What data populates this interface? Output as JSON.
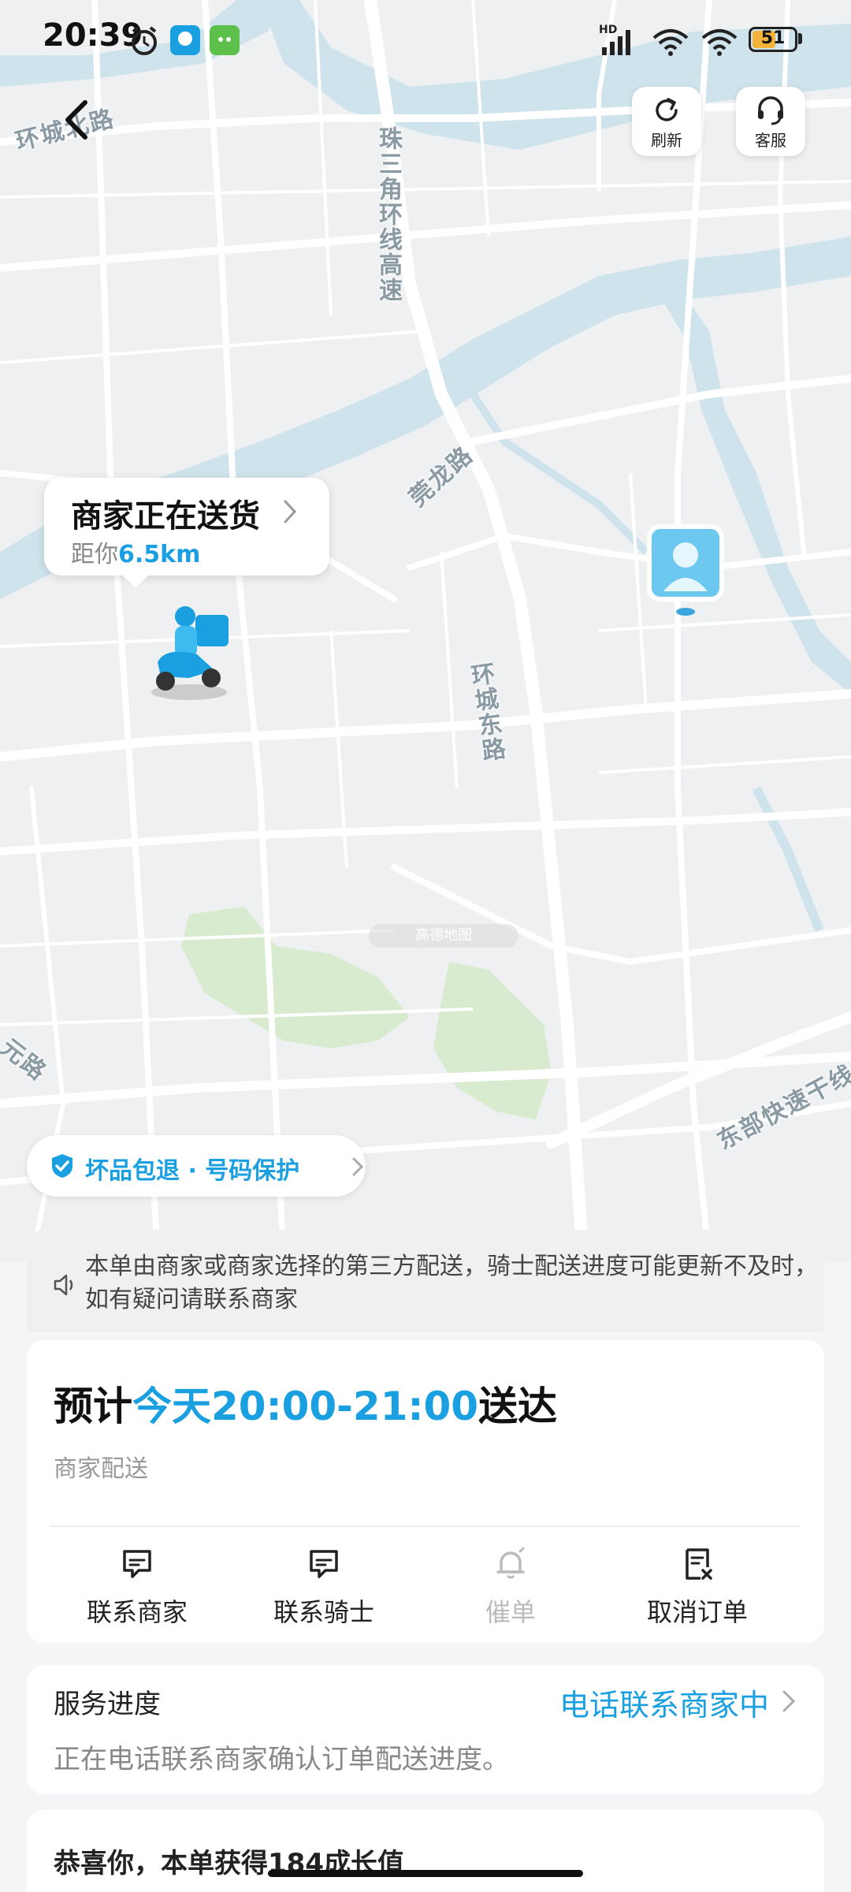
{
  "status_bar": {
    "time": "20:39",
    "signal_label": "HD",
    "battery": "51",
    "battery_level": 0.51
  },
  "top_controls": {
    "refresh_label": "刷新",
    "service_label": "客服"
  },
  "map": {
    "road_labels": [
      "环城北路",
      "珠三角环线高速",
      "莞龙路",
      "环城东路",
      "东部快速干线",
      "元路"
    ],
    "watermark": "高德地图"
  },
  "status_bubble": {
    "title": "商家正在送货",
    "distance_prefix": "距你",
    "distance": "6.5km"
  },
  "guarantee": {
    "text": "坏品包退 · 号码保护"
  },
  "notice": {
    "text": "本单由商家或商家选择的第三方配送，骑士配送进度可能更新不及时，如有疑问请联系商家"
  },
  "delivery": {
    "eta_prefix": "预计",
    "eta_time": "今天20:00-21:00",
    "eta_suffix": "送达",
    "mode": "商家配送",
    "actions": [
      {
        "label": "联系商家",
        "icon": "chat-icon",
        "enabled": true
      },
      {
        "label": "联系骑士",
        "icon": "chat-icon",
        "enabled": true
      },
      {
        "label": "催单",
        "icon": "bell-icon",
        "enabled": false
      },
      {
        "label": "取消订单",
        "icon": "cancel-doc-icon",
        "enabled": true
      }
    ]
  },
  "service": {
    "title": "服务进度",
    "status": "电话联系商家中",
    "description": "正在电话联系商家确认订单配送进度。"
  },
  "bottom_peek": {
    "text": "恭喜你，本单获得184成长值"
  },
  "colors": {
    "accent": "#1aa0e0",
    "river": "#cfe3ec",
    "park": "#d9ebcf"
  }
}
